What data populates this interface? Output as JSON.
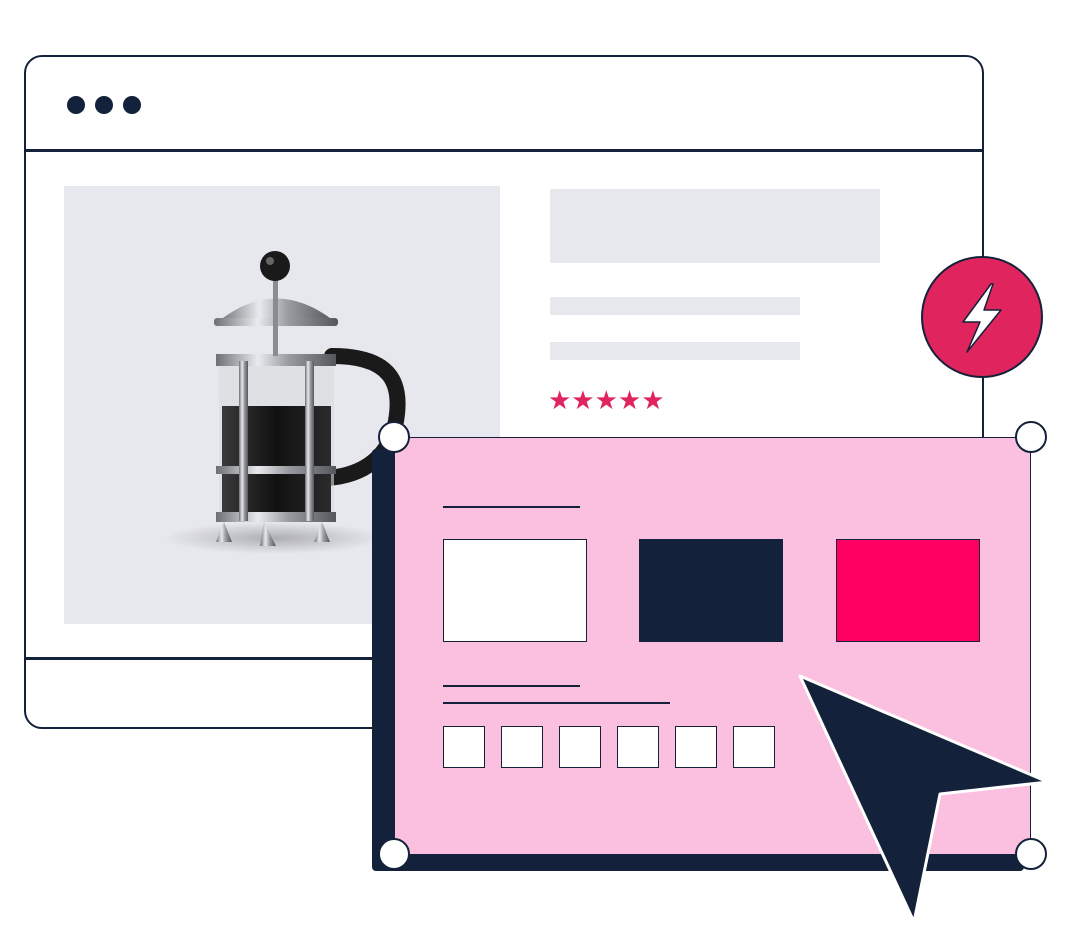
{
  "illustration": {
    "browser_window": {
      "controls": [
        "window-dot",
        "window-dot",
        "window-dot"
      ]
    },
    "product": {
      "image": "french-press",
      "rating": 5,
      "rating_text": "★★★★★",
      "star_color": "#e0245e"
    },
    "badge_icon": "lightning-icon",
    "editor": {
      "swatches": [
        {
          "name": "white",
          "color": "#ffffff"
        },
        {
          "name": "navy",
          "color": "#14213a"
        },
        {
          "name": "pink",
          "color": "#ff0062"
        }
      ],
      "option_count": 6
    },
    "cursor_icon": "cursor-arrow-icon"
  },
  "colors": {
    "navy": "#14213a",
    "pink_panel": "#fbbfe0",
    "accent": "#e0245e",
    "placeholder": "#e7e8ee"
  }
}
